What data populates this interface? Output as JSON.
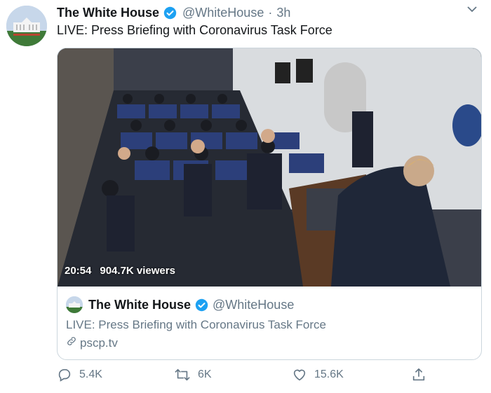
{
  "tweet": {
    "author_name": "The White House",
    "author_handle": "@WhiteHouse",
    "separator": "·",
    "time": "3h",
    "text": "LIVE: Press Briefing with Coronavirus Task Force"
  },
  "media": {
    "duration": "20:54",
    "viewers": "904.7K viewers"
  },
  "card": {
    "author_name": "The White House",
    "author_handle": "@WhiteHouse",
    "title": "LIVE: Press Briefing with Coronavirus Task Force",
    "link": "pscp.tv"
  },
  "actions": {
    "replies": "5.4K",
    "retweets": "6K",
    "likes": "15.6K"
  },
  "colors": {
    "verified": "#1da1f2",
    "muted": "#657786",
    "text": "#14171a"
  },
  "icons": [
    "verified-badge-icon",
    "chevron-down-icon",
    "reply-icon",
    "retweet-icon",
    "like-icon",
    "share-icon",
    "link-icon"
  ]
}
